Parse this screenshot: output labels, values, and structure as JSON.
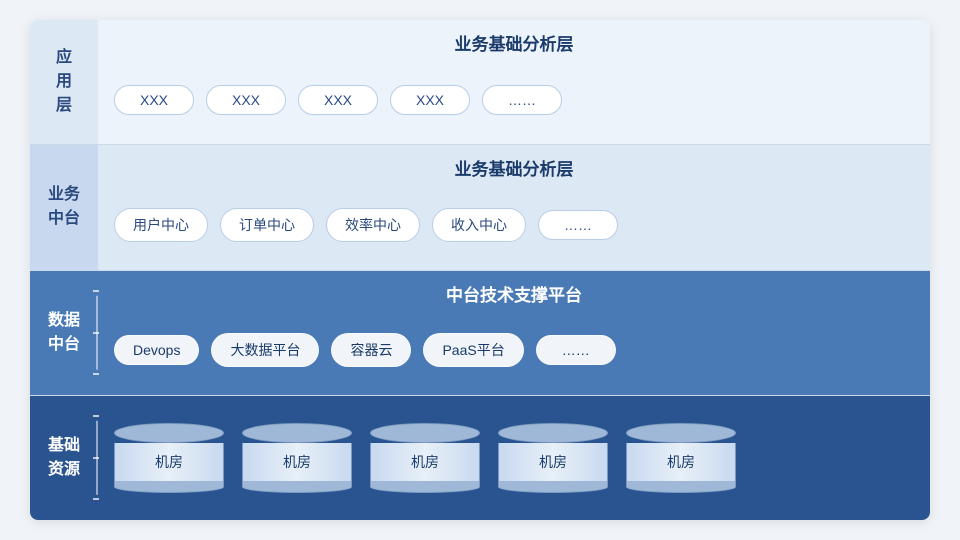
{
  "diagram": {
    "layers": [
      {
        "id": "app",
        "label": "应\n用\n层",
        "title": "业务基础分析层",
        "labelStyle": "app",
        "contentStyle": "app",
        "titleDark": false,
        "type": "cards",
        "cards": [
          "XXX",
          "XXX",
          "XXX",
          "XXX",
          "……"
        ]
      },
      {
        "id": "biz",
        "label": "业\n务\n中\n台",
        "title": "业务基础分析层",
        "labelStyle": "biz",
        "contentStyle": "biz",
        "titleDark": false,
        "type": "cards",
        "cards": [
          "用户中心",
          "订单中心",
          "效率中心",
          "收入中心",
          "……"
        ]
      },
      {
        "id": "data",
        "label": "数\n据\n中\n台",
        "title": "中台技术支撑平台",
        "labelStyle": "data",
        "contentStyle": "data",
        "titleDark": true,
        "type": "cards",
        "cards": [
          "Devops",
          "大数据平台",
          "容器云",
          "PaaS平台",
          "……"
        ],
        "hasTicks": true
      },
      {
        "id": "infra",
        "label": "基\n础\n资\n源",
        "title": null,
        "labelStyle": "infra",
        "contentStyle": "infra",
        "titleDark": true,
        "type": "cylinders",
        "cylinders": [
          "机房",
          "机房",
          "机房",
          "机房",
          "机房"
        ],
        "hasTicks": true
      }
    ]
  }
}
